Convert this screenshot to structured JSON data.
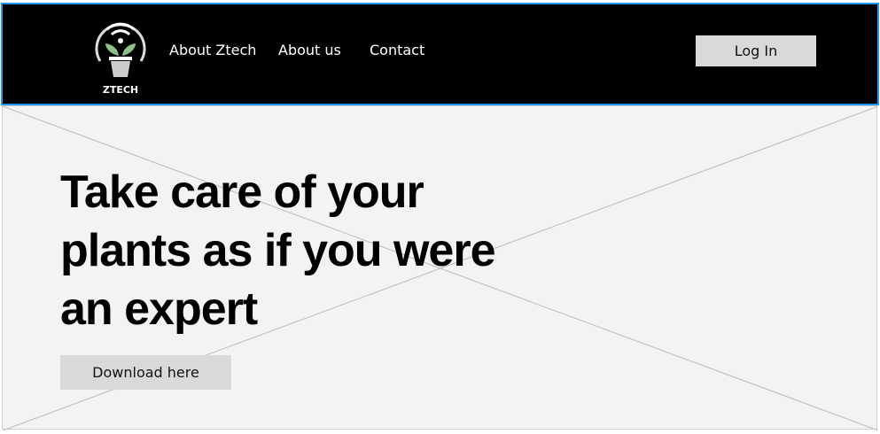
{
  "header": {
    "logo_text": "ZTECH",
    "nav": [
      {
        "label": "About Ztech"
      },
      {
        "label": "About us"
      },
      {
        "label": "Contact"
      }
    ],
    "login_label": "Log In",
    "border_color": "#2196f3"
  },
  "hero": {
    "headline": "Take care of your plants as if you were an expert",
    "download_label": "Download here"
  }
}
